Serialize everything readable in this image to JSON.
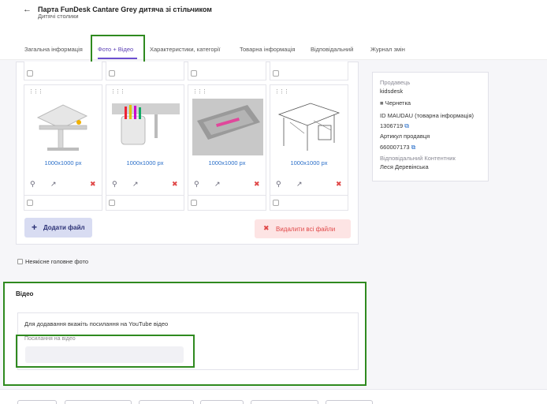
{
  "header": {
    "title": "Парта FunDesk Cantare Grey дитяча зі стільчиком",
    "subtitle": "Дитячі столики"
  },
  "tabs": [
    {
      "label": "Загальна інформація"
    },
    {
      "label": "Фото + Відео"
    },
    {
      "label": "Характеристики, категорії"
    },
    {
      "label": "Товарна інформація"
    },
    {
      "label": "Відповідальний"
    },
    {
      "label": "Журнал змін"
    }
  ],
  "photos": [
    {
      "size": "1000x1000 px",
      "icon": "desk-frame-photo"
    },
    {
      "size": "1000x1000 px",
      "icon": "pencil-cup-photo"
    },
    {
      "size": "1000x1000 px",
      "icon": "desk-tray-photo"
    },
    {
      "size": "1000x1000 px",
      "icon": "desk-sketch-photo"
    }
  ],
  "actions": {
    "add_file": "Додати файл",
    "delete_all": "Видалити всі файли"
  },
  "low_quality_label": "Неякісне головне фото",
  "video": {
    "title": "Відео",
    "hint": "Для додавання вкажіть посилання на YouTube відео",
    "link_label": "Посилання на відео",
    "link_value": ""
  },
  "seller": {
    "seller_label": "Продавець",
    "seller_name": "kidsdesk",
    "status": "Чернетка",
    "id_label": "ID MAUDAU (товарна інформація)",
    "id_value": "1306719",
    "article_label": "Артикул продавця",
    "article_value": "660007173",
    "responsible_label": "Відповідальний Контентник",
    "responsible_name": "Леся Деревінська"
  },
  "colors": {
    "accent": "#6c4fd0",
    "highlight": "#2f8a1f",
    "danger": "#e04848",
    "link": "#2a6fc9"
  }
}
